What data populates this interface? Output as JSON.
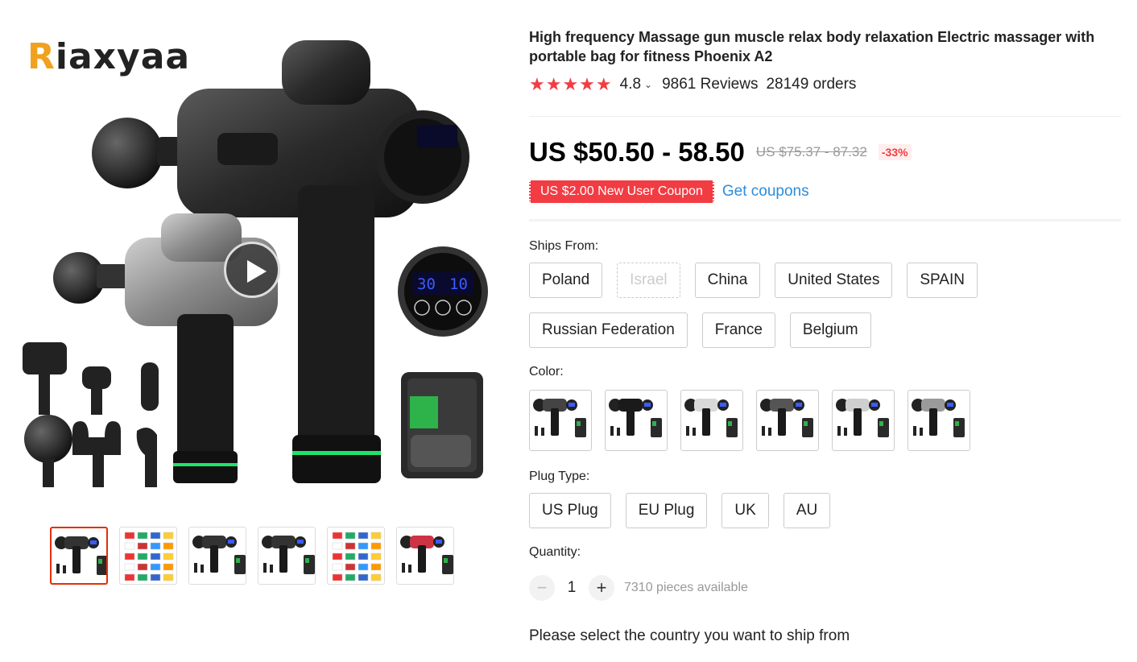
{
  "brand": {
    "logo_first": "R",
    "logo_rest": "iaxyaa"
  },
  "product": {
    "title": "High frequency Massage gun muscle relax body relaxation Electric massager with portable bag for fitness Phoenix A2",
    "stars": "★★★★★",
    "rating": "4.8",
    "rating_chevron": "⌄",
    "reviews": "9861 Reviews",
    "orders": "28149 orders"
  },
  "price": {
    "current": "US $50.50 - 58.50",
    "original": "US $75.37 - 87.32",
    "discount": "-33%"
  },
  "coupon": {
    "label": "US $2.00 New User Coupon",
    "link": "Get coupons"
  },
  "ships_from": {
    "label": "Ships From:",
    "options": [
      "Poland",
      "Israel",
      "China",
      "United States",
      "SPAIN",
      "Russian Federation",
      "France",
      "Belgium"
    ],
    "disabled": [
      "Israel"
    ]
  },
  "color": {
    "label": "Color:",
    "swatch_count": 6
  },
  "plug_type": {
    "label": "Plug Type:",
    "options": [
      "US Plug",
      "EU Plug",
      "UK",
      "AU"
    ]
  },
  "quantity": {
    "label": "Quantity:",
    "minus": "−",
    "value": "1",
    "plus": "+",
    "available": "7310 pieces available"
  },
  "notice": "Please select the country you want to ship from",
  "display": {
    "digit_left": "30",
    "digit_right": "10"
  },
  "colors": {
    "accent": "#f23c43",
    "link": "#2d8ddb",
    "brand_orange": "#f0a11e",
    "active_thumb": "#e62e04"
  }
}
